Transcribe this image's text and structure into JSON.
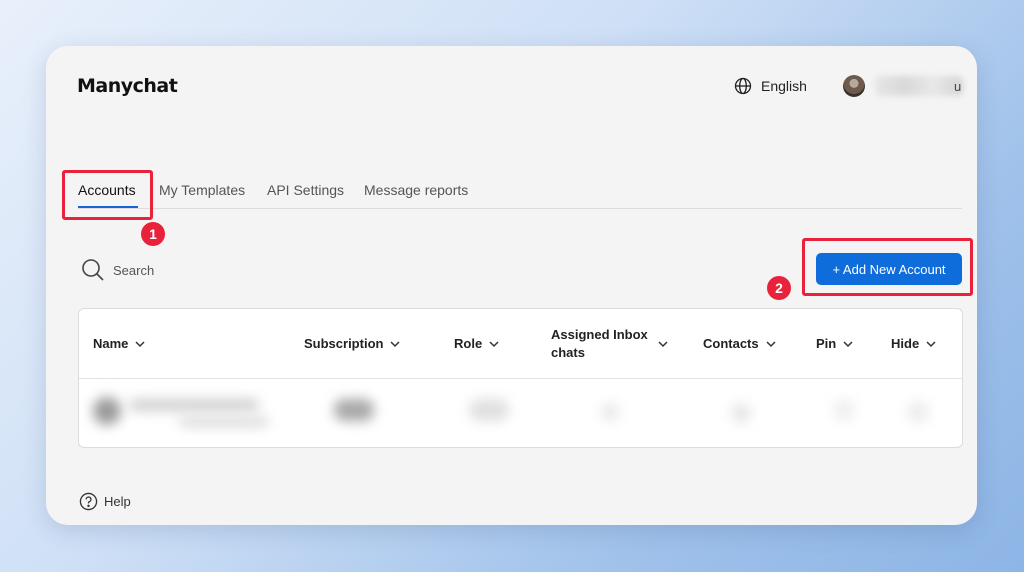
{
  "app": {
    "logo_text": "Manychat"
  },
  "header": {
    "language": "English",
    "user_suffix": "u"
  },
  "tabs": [
    {
      "label": "Accounts",
      "active": true
    },
    {
      "label": "My Templates"
    },
    {
      "label": "API Settings"
    },
    {
      "label": "Message reports"
    }
  ],
  "search": {
    "placeholder": "Search"
  },
  "actions": {
    "add_account": "+ Add New Account"
  },
  "table": {
    "columns": [
      {
        "label": "Name"
      },
      {
        "label": "Subscription"
      },
      {
        "label": "Role"
      },
      {
        "label": "Assigned Inbox chats"
      },
      {
        "label": "Contacts"
      },
      {
        "label": "Pin"
      },
      {
        "label": "Hide"
      }
    ]
  },
  "annotations": {
    "step1": "1",
    "step2": "2"
  },
  "footer": {
    "help": "Help"
  },
  "colors": {
    "accent": "#0f6ddb",
    "highlight": "#e8223a",
    "card_bg": "#f4f4f4"
  },
  "icons": {
    "language": "globe-icon",
    "search": "search-icon",
    "help": "help-circle-icon",
    "sort": "chevron-down-icon"
  }
}
